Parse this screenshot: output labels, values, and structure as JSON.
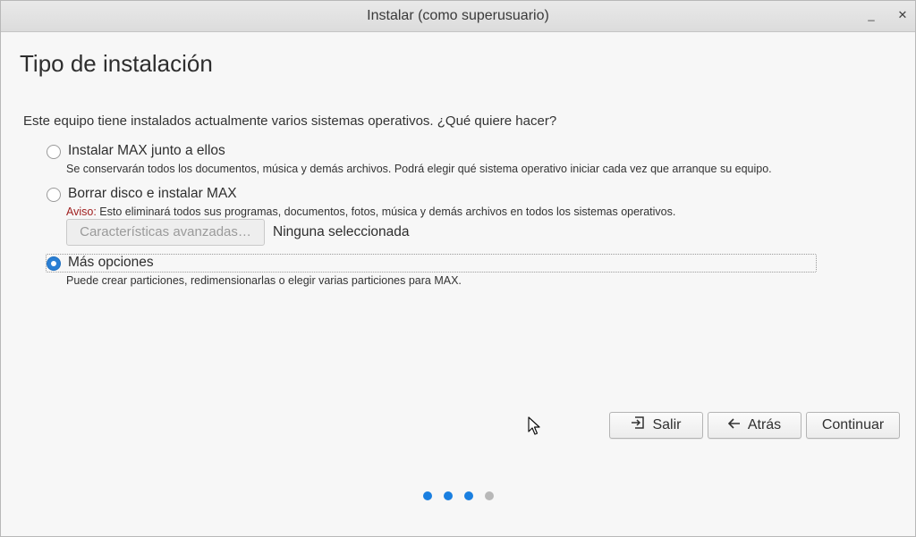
{
  "window": {
    "title": "Instalar (como superusuario)",
    "minimize_glyph": "_",
    "close_glyph": "✕"
  },
  "page": {
    "title": "Tipo de instalación",
    "question": "Este equipo tiene instalados actualmente varios sistemas operativos. ¿Qué quiere hacer?"
  },
  "options": [
    {
      "label": "Instalar MAX junto a ellos",
      "description": "Se conservarán todos los documentos, música y demás archivos. Podrá elegir qué sistema operativo iniciar cada vez que arranque su equipo.",
      "selected": false
    },
    {
      "label": "Borrar disco e instalar MAX",
      "warning_prefix": "Aviso:",
      "description": " Esto eliminará todos sus programas, documentos, fotos, música y demás archivos en todos los sistemas operativos.",
      "selected": false
    },
    {
      "label": "Más opciones",
      "description": "Puede crear particiones, redimensionarlas o elegir varias particiones para MAX.",
      "selected": true
    }
  ],
  "advanced": {
    "button_label": "Características avanzadas…",
    "status": "Ninguna seleccionada"
  },
  "buttons": {
    "quit": "Salir",
    "back": "Atrás",
    "continue": "Continuar"
  },
  "progress": {
    "total_steps": 4,
    "completed_steps": 3,
    "active_color": "#1a7fe0",
    "inactive_color": "#b8b8b8"
  },
  "colors": {
    "accent": "#2a7fd4",
    "warning": "#a02020"
  }
}
